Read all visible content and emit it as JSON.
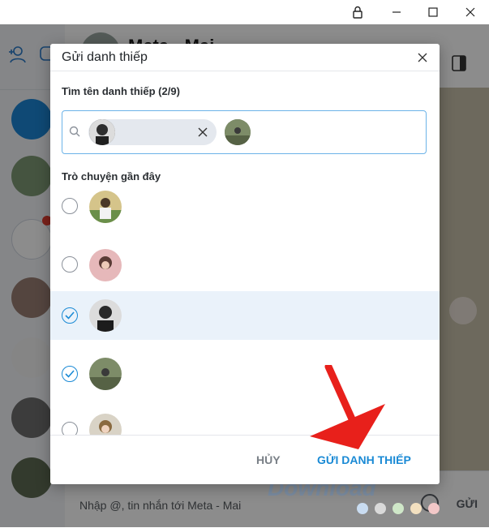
{
  "header": {
    "contact_name": "Meta - Mai"
  },
  "composer": {
    "placeholder": "Nhập @, tin nhắn tới Meta - Mai",
    "send_label": "GỬI"
  },
  "watermark": "Download",
  "modal": {
    "title": "Gửi danh thiếp",
    "search_label": "Tìm tên danh thiếp (2/9)",
    "recent_label": "Trò chuyện gần đây",
    "cancel_label": "HỦY",
    "send_label": "GỬI DANH THIẾP",
    "recent": [
      {
        "checked": false
      },
      {
        "checked": false
      },
      {
        "checked": true
      },
      {
        "checked": true
      },
      {
        "checked": false
      }
    ]
  },
  "colors": {
    "accent": "#1a8ad5",
    "selected_row": "#eaf2fa",
    "annotation_arrow": "#e8201b"
  }
}
